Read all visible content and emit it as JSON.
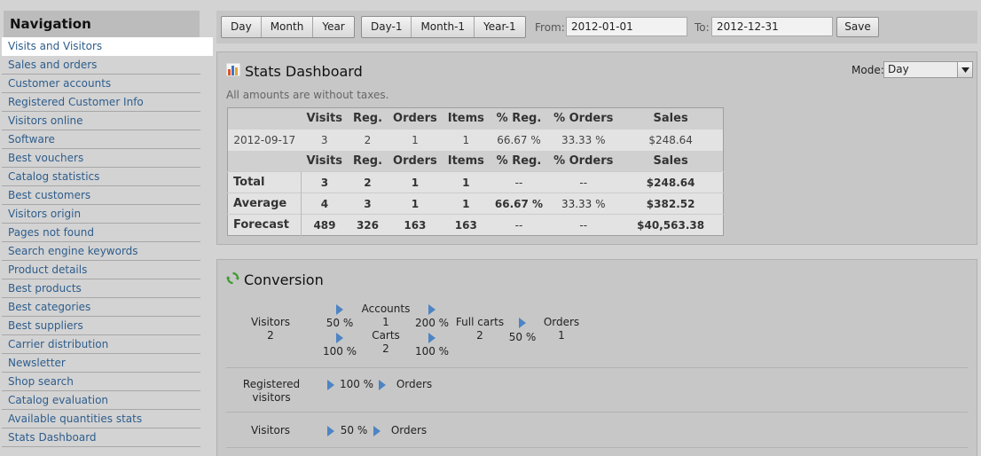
{
  "nav": {
    "title": "Navigation",
    "items": [
      "Visits and Visitors",
      "Sales and orders",
      "Customer accounts",
      "Registered Customer Info",
      "Visitors online",
      "Software",
      "Best vouchers",
      "Catalog statistics",
      "Best customers",
      "Visitors origin",
      "Pages not found",
      "Search engine keywords",
      "Product details",
      "Best products",
      "Best categories",
      "Best suppliers",
      "Carrier distribution",
      "Newsletter",
      "Shop search",
      "Catalog evaluation",
      "Available quantities stats",
      "Stats Dashboard"
    ],
    "active_index": 0
  },
  "toolbar": {
    "period_buttons": [
      "Day",
      "Month",
      "Year"
    ],
    "prev_buttons": [
      "Day-1",
      "Month-1",
      "Year-1"
    ],
    "from_label": "From:",
    "from_value": "2012-01-01",
    "to_label": "To:",
    "to_value": "2012-12-31",
    "save_label": "Save"
  },
  "dashboard": {
    "title": "Stats Dashboard",
    "mode_label": "Mode:",
    "mode_value": "Day",
    "tax_note": "All amounts are without taxes.",
    "columns": [
      "Visits",
      "Reg.",
      "Orders",
      "Items",
      "% Reg.",
      "% Orders",
      "Sales"
    ],
    "rows": [
      [
        "2012-09-17",
        "3",
        "2",
        "1",
        "1",
        "66.67 %",
        "33.33 %",
        "$248.64"
      ]
    ],
    "summary": [
      [
        "Total",
        "3",
        "2",
        "1",
        "1",
        "--",
        "--",
        "$248.64"
      ],
      [
        "Average",
        "4",
        "3",
        "1",
        "1",
        "66.67 %",
        "33.33 %",
        "$382.52"
      ],
      [
        "Forecast",
        "489",
        "326",
        "163",
        "163",
        "--",
        "--",
        "$40,563.38"
      ]
    ]
  },
  "conversion": {
    "title": "Conversion",
    "funnel": {
      "visitors_label": "Visitors",
      "visitors_value": "2",
      "to_accounts_pct": "50 %",
      "accounts_label": "Accounts",
      "accounts_value": "1",
      "accounts_to_full_pct": "200 %",
      "to_carts_pct": "100 %",
      "carts_label": "Carts",
      "carts_value": "2",
      "carts_to_full_pct": "100 %",
      "full_carts_label": "Full carts",
      "full_carts_value": "2",
      "full_to_orders_pct": "50 %",
      "orders_label": "Orders",
      "orders_value": "1"
    },
    "registered": {
      "label_line1": "Registered",
      "label_line2": "visitors",
      "pct": "100 %",
      "target": "Orders"
    },
    "visitors": {
      "label": "Visitors",
      "pct": "50 %",
      "target": "Orders"
    }
  },
  "colors": {
    "link": "#2e5d8c",
    "arrow": "#4d84c4",
    "panel_bg": "#c7c7c7",
    "table_bg": "#e3e3e3"
  },
  "icons": {
    "dashboard": "bar-chart-icon",
    "conversion": "refresh-icon",
    "mode_dropdown": "chevron-down-icon"
  }
}
